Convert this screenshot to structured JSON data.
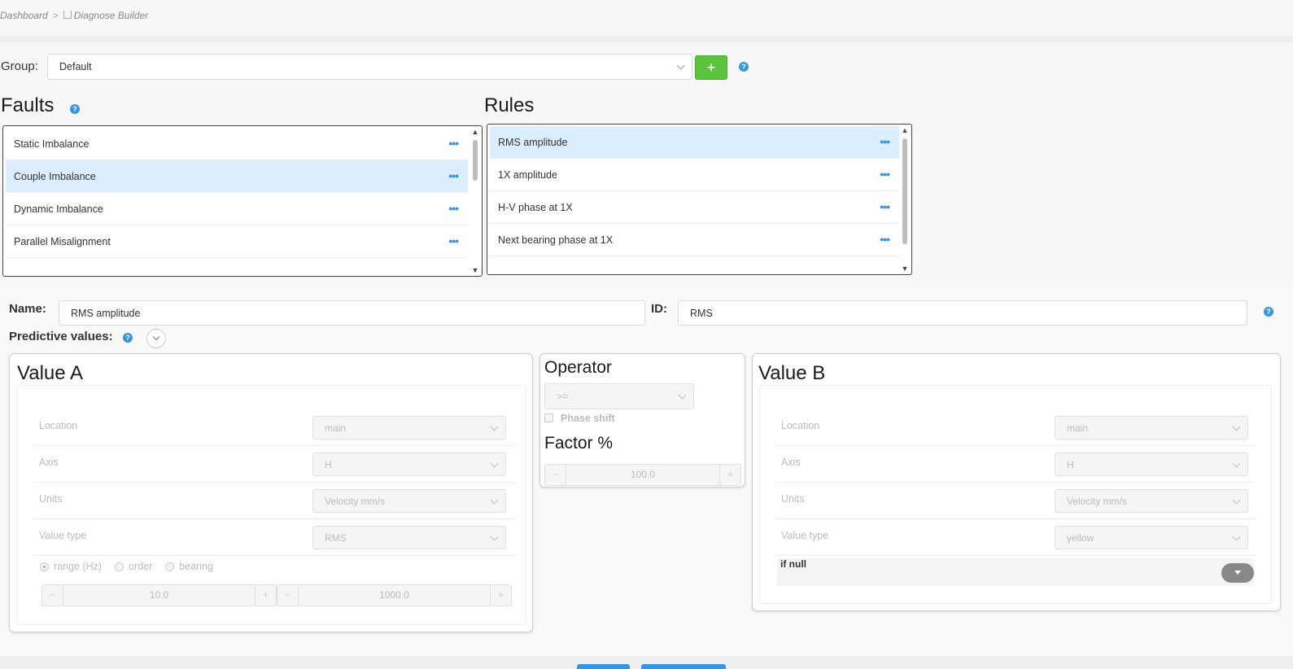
{
  "breadcrumb": {
    "home": "Dashboard",
    "separator": ">",
    "current": "Diagnose Builder"
  },
  "group": {
    "label": "Group:",
    "value": "Default",
    "add_label": "+",
    "help": "?"
  },
  "faults": {
    "title": "Faults",
    "help": "?",
    "items": [
      {
        "label": "Static Imbalance",
        "selected": false
      },
      {
        "label": "Couple Imbalance",
        "selected": true
      },
      {
        "label": "Dynamic Imbalance",
        "selected": false
      },
      {
        "label": "Parallel Misalignment",
        "selected": false
      }
    ],
    "more": "•••"
  },
  "rules": {
    "title": "Rules",
    "items": [
      {
        "label": "RMS amplitude",
        "selected": true
      },
      {
        "label": "1X amplitude",
        "selected": false
      },
      {
        "label": "H-V phase at 1X",
        "selected": false
      },
      {
        "label": "Next bearing phase at 1X",
        "selected": false
      }
    ],
    "more": "•••"
  },
  "rule_form": {
    "name_label": "Name:",
    "name_value": "RMS amplitude",
    "id_label": "ID:",
    "id_value": "RMS",
    "help": "?",
    "predictive_label": "Predictive values:"
  },
  "value_a": {
    "title": "Value A",
    "location_label": "Location",
    "location_value": "main",
    "axis_label": "Axis",
    "axis_value": "H",
    "units_label": "Units",
    "units_value": "Velocity mm/s",
    "value_type_label": "Value type",
    "value_type_value": "RMS",
    "radio_range": "range (Hz)",
    "radio_order": "order",
    "radio_bearing": "bearing",
    "range_from": "10.0",
    "range_to": "1000.0",
    "minus": "−",
    "plus": "+"
  },
  "operator": {
    "title": "Operator",
    "value": ">=",
    "phase_shift_label": "Phase shift",
    "factor_title": "Factor %",
    "factor_value": "100.0",
    "minus": "−",
    "plus": "+"
  },
  "value_b": {
    "title": "Value B",
    "location_label": "Location",
    "location_value": "main",
    "axis_label": "Axis",
    "axis_value": "H",
    "units_label": "Units",
    "units_value": "Velocity mm/s",
    "value_type_label": "Value type",
    "value_type_value": "yellow",
    "if_null_label": "if null"
  },
  "colors": {
    "accent": "#3a95e0",
    "add_button": "#5cc33f",
    "selected_row": "#dbeeff"
  }
}
